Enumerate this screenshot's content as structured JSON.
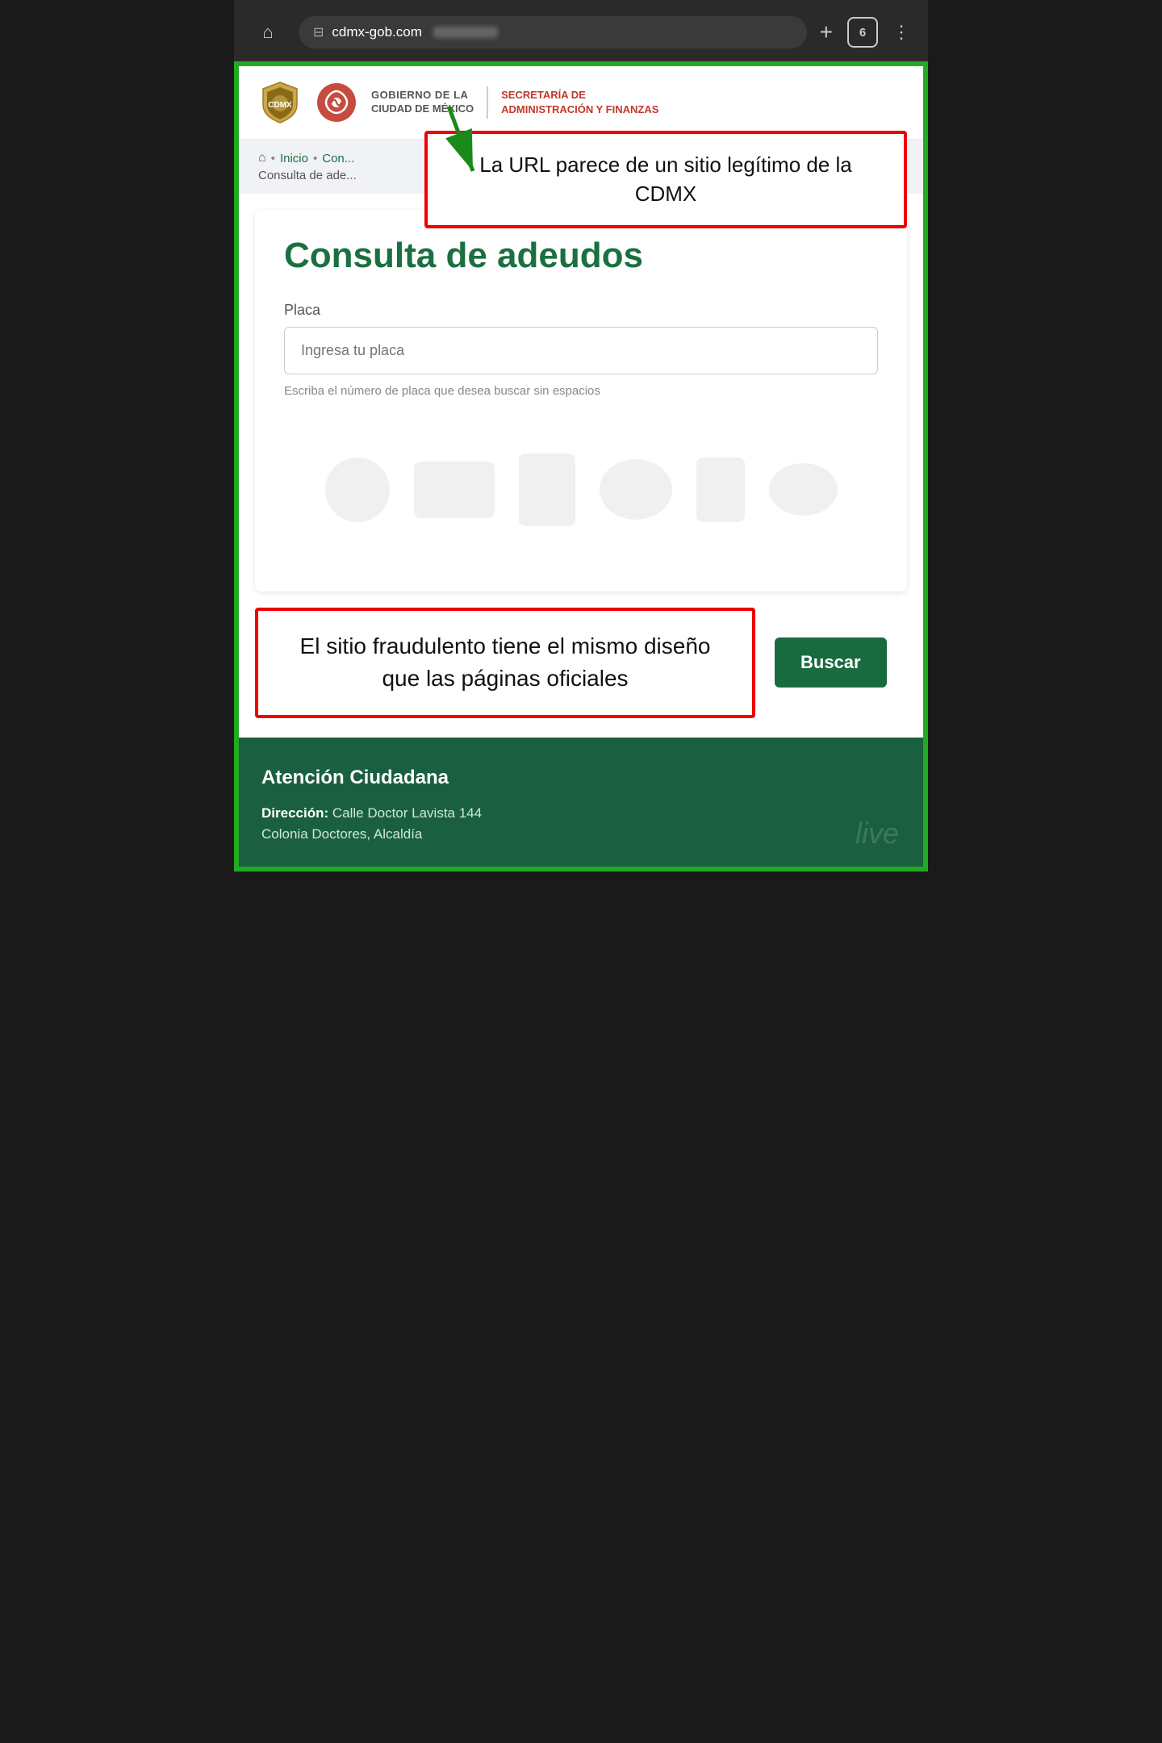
{
  "browser": {
    "home_icon": "⌂",
    "url_domain": "cdmx-gob.com",
    "url_icon": "⊟",
    "add_tab": "+",
    "tabs_count": "6",
    "menu_icon": "⋮"
  },
  "callout_url": {
    "text": "La URL parece de un sitio legítimo de la CDMX"
  },
  "header": {
    "gov_line1": "GOBIERNO DE LA",
    "gov_line2": "CIUDAD DE MÉXICO",
    "sec_line1": "SECRETARÍA DE",
    "sec_line2": "ADMINISTRACIÓN Y FINANZAS"
  },
  "breadcrumb": {
    "home_icon": "⌂",
    "items": [
      "Inicio",
      "Con..."
    ],
    "page_label": "Consulta de ade..."
  },
  "main": {
    "page_title": "Consulta de adeudos",
    "form_label": "Placa",
    "form_placeholder": "Ingresa tu placa",
    "form_hint": "Escriba el número de placa que desea buscar sin espacios"
  },
  "callout_fraud": {
    "text": "El sitio fraudulento tiene el mismo diseño que las páginas oficiales"
  },
  "buscar_button": {
    "label": "Buscar"
  },
  "footer": {
    "title": "Atención Ciudadana",
    "address_label": "Dirección:",
    "address_value": "Calle Doctor Lavista 144",
    "colonia": "Colonia Doctores, Alcaldía",
    "watermark": "live"
  }
}
